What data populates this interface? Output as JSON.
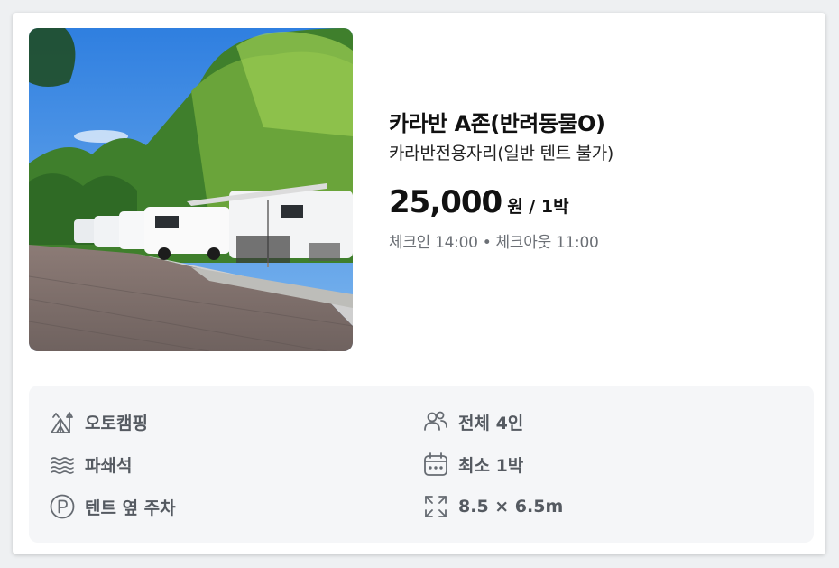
{
  "listing": {
    "title": "카라반 A존(반려동물O)",
    "subtitle": "카라반전용자리(일반 텐트 불가)",
    "price": "25,000",
    "price_unit": "원 / 1박",
    "checkin_checkout": "체크인 14:00 • 체크아웃 11:00",
    "photo_alt": "campsite-photo"
  },
  "features": [
    {
      "icon": "tent-icon",
      "label": "오토캠핑"
    },
    {
      "icon": "people-icon",
      "label": "전체 4인"
    },
    {
      "icon": "gravel-icon",
      "label": "파쇄석"
    },
    {
      "icon": "calendar-icon",
      "label": "최소 1박"
    },
    {
      "icon": "parking-icon",
      "label": "텐트 옆 주차"
    },
    {
      "icon": "expand-icon",
      "label": "8.5 × 6.5m"
    }
  ],
  "colors": {
    "card_bg": "#ffffff",
    "features_bg": "#f5f6f8",
    "icon_color": "#666b72",
    "title_color": "#111111",
    "muted_text": "#6b6f75"
  }
}
